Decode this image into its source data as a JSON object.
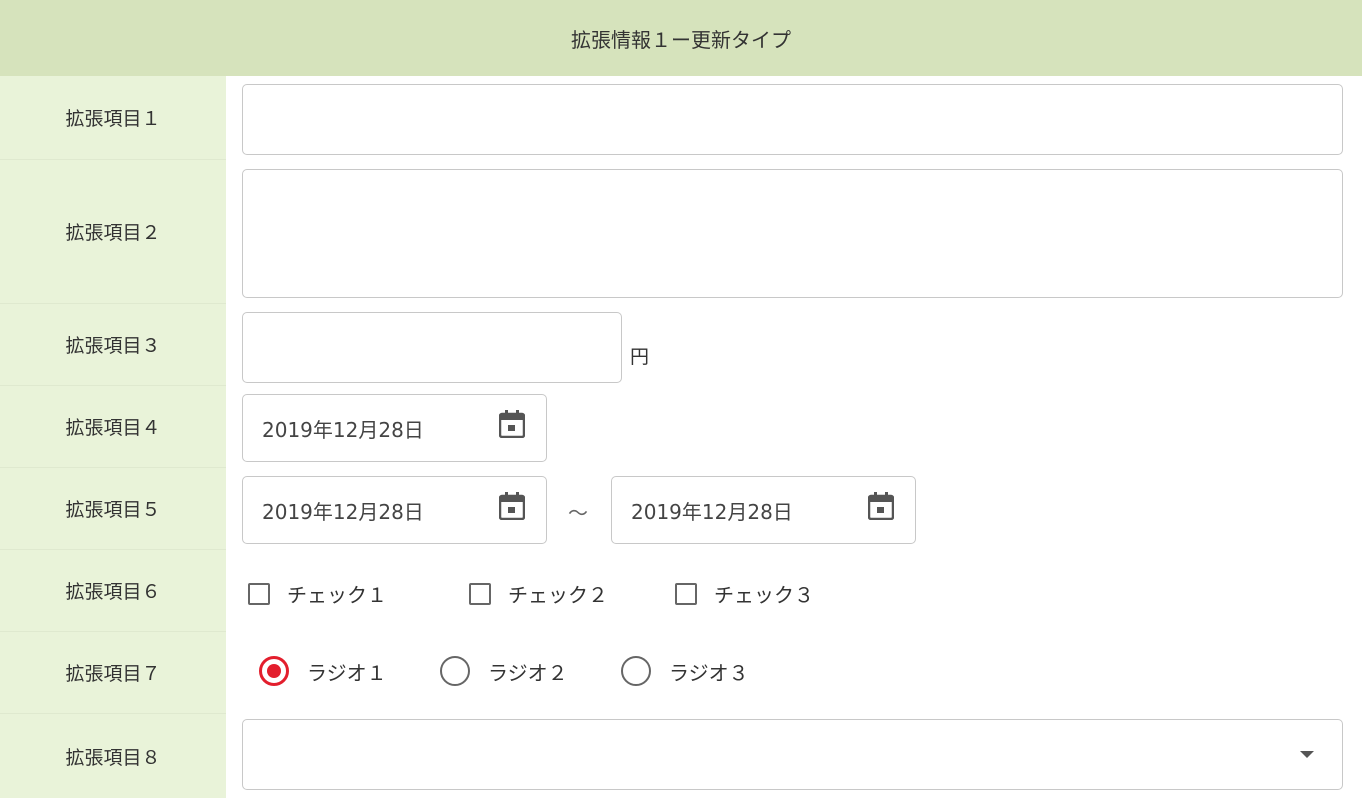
{
  "header": {
    "title": "拡張情報１ー更新タイプ"
  },
  "rows": [
    {
      "label": "拡張項目１"
    },
    {
      "label": "拡張項目２"
    },
    {
      "label": "拡張項目３"
    },
    {
      "label": "拡張項目４"
    },
    {
      "label": "拡張項目５"
    },
    {
      "label": "拡張項目６"
    },
    {
      "label": "拡張項目７"
    },
    {
      "label": "拡張項目８"
    }
  ],
  "fields": {
    "item1": {
      "value": ""
    },
    "item2": {
      "value": ""
    },
    "item3": {
      "value": "",
      "unit": "円"
    },
    "item4": {
      "date": "2019年12月28日",
      "icon": "calendar-icon"
    },
    "item5": {
      "from": "2019年12月28日",
      "separator": "～",
      "to": "2019年12月28日",
      "icon": "calendar-icon"
    },
    "item6": {
      "checks": [
        {
          "label": "チェック１",
          "checked": false
        },
        {
          "label": "チェック２",
          "checked": false
        },
        {
          "label": "チェック３",
          "checked": false
        }
      ]
    },
    "item7": {
      "radios": [
        {
          "label": "ラジオ１",
          "selected": true
        },
        {
          "label": "ラジオ２",
          "selected": false
        },
        {
          "label": "ラジオ３",
          "selected": false
        }
      ]
    },
    "item8": {
      "value": "",
      "icon": "dropdown-caret-icon"
    }
  },
  "colors": {
    "header_bg": "#d6e3bc",
    "label_bg": "#e9f3d9",
    "radio_accent": "#e31e2d"
  }
}
